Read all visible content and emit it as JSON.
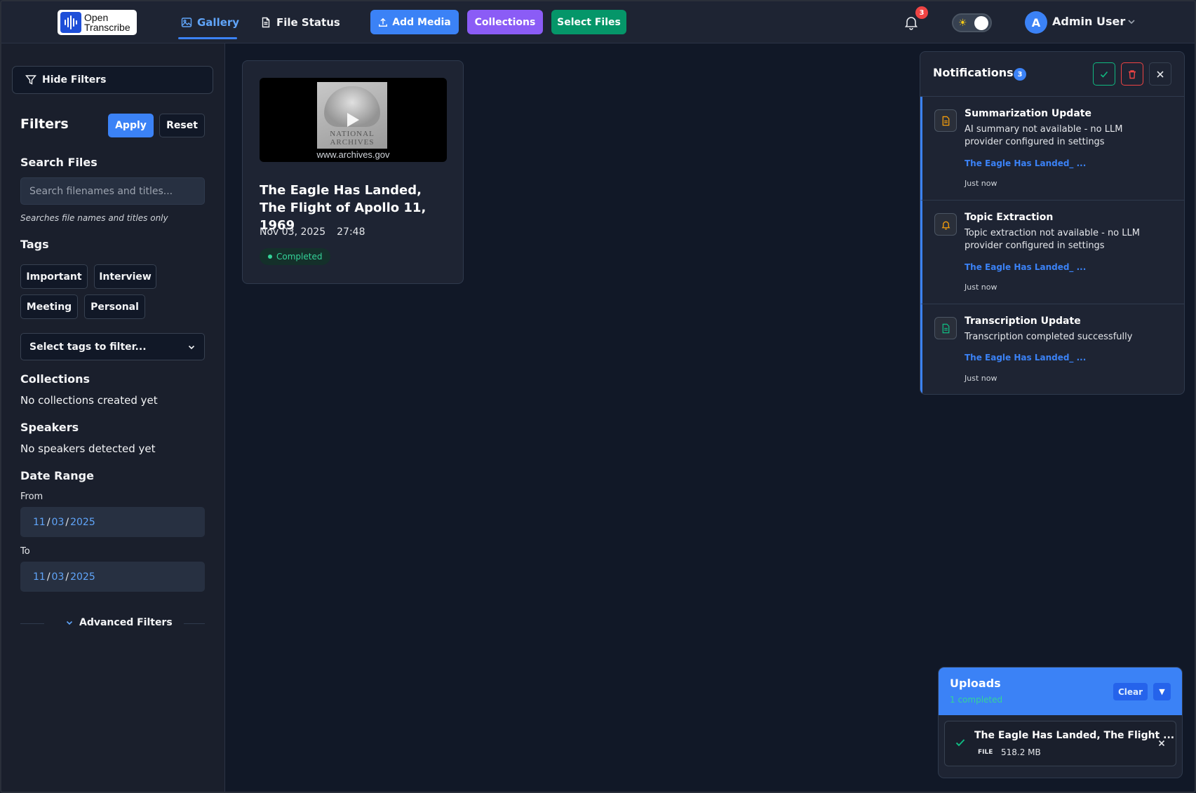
{
  "app": {
    "logo_line1": "Open",
    "logo_line2": "Transcribe"
  },
  "nav": {
    "tabs": [
      {
        "label": "Gallery",
        "icon": "image-icon",
        "active": true
      },
      {
        "label": "File Status",
        "icon": "file-icon",
        "active": false
      }
    ],
    "buttons": {
      "add_media": "Add Media",
      "collections": "Collections",
      "select_files": "Select Files"
    },
    "notification_count": "3",
    "user_initial": "A",
    "user_name": "Admin User"
  },
  "sidebar": {
    "hide_filters": "Hide Filters",
    "filters_title": "Filters",
    "apply": "Apply",
    "reset": "Reset",
    "search": {
      "title": "Search Files",
      "placeholder": "Search filenames and titles...",
      "hint": "Searches file names and titles only"
    },
    "tags": {
      "title": "Tags",
      "items": [
        "Important",
        "Interview",
        "Meeting",
        "Personal"
      ],
      "select_placeholder": "Select tags to filter..."
    },
    "collections": {
      "title": "Collections",
      "empty": "No collections created yet"
    },
    "speakers": {
      "title": "Speakers",
      "empty": "No speakers detected yet"
    },
    "date_range": {
      "title": "Date Range",
      "from_label": "From",
      "from": {
        "month": "11",
        "day": "03",
        "year": "2025"
      },
      "to_label": "To",
      "to": {
        "month": "11",
        "day": "03",
        "year": "2025"
      }
    },
    "advanced": "Advanced Filters"
  },
  "media": [
    {
      "title": "The Eagle Has Landed, The Flight of Apollo 11, 1969",
      "date": "Nov 03, 2025",
      "duration": "27:48",
      "status": "Completed",
      "thumb_caption_1": "NATIONAL",
      "thumb_caption_2": "ARCHIVES",
      "thumb_url": "www.archives.gov"
    }
  ],
  "notifications": {
    "title": "Notifications",
    "count": "3",
    "items": [
      {
        "title": "Summarization Update",
        "body": "AI summary not available - no LLM provider configured in settings",
        "link": "The Eagle Has Landed_ ...",
        "time": "Just now",
        "icon": "document-icon",
        "color": "#f59e0b"
      },
      {
        "title": "Topic Extraction",
        "body": "Topic extraction not available - no LLM provider configured in settings",
        "link": "The Eagle Has Landed_ ...",
        "time": "Just now",
        "icon": "bell-icon",
        "color": "#f59e0b"
      },
      {
        "title": "Transcription Update",
        "body": "Transcription completed successfully",
        "link": "The Eagle Has Landed_ ...",
        "time": "Just now",
        "icon": "document-icon",
        "color": "#10b981"
      }
    ]
  },
  "uploads": {
    "title": "Uploads",
    "subtitle": "1 completed",
    "clear": "Clear",
    "toggle": "▼",
    "items": [
      {
        "name": "The Eagle Has Landed, The Flight ...",
        "type": "FILE",
        "size": "518.2 MB",
        "status": "completed"
      }
    ]
  }
}
